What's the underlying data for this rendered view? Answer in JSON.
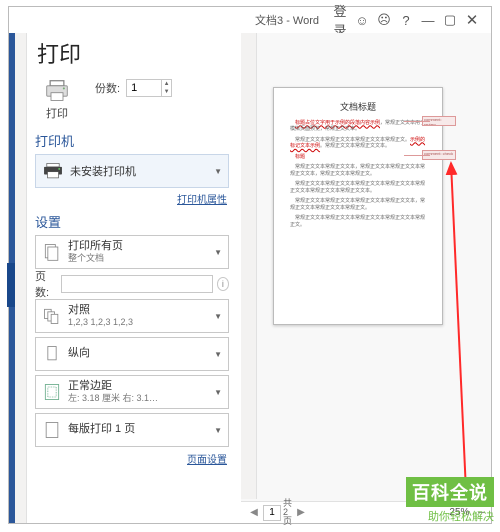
{
  "titlebar": {
    "doc": "文档3 - Word",
    "login": "登录"
  },
  "page_title": "打印",
  "print": {
    "btn": "打印",
    "copies_label": "份数:",
    "copies_value": "1"
  },
  "printer": {
    "heading": "打印机",
    "name": "未安装打印机",
    "props_link": "打印机属性"
  },
  "settings": {
    "heading": "设置",
    "scope": {
      "l1": "打印所有页",
      "l2": "整个文档"
    },
    "pages_label": "页数:",
    "collate": {
      "l1": "对照",
      "l2": "1,2,3    1,2,3    1,2,3"
    },
    "orient": {
      "l1": "纵向"
    },
    "margins": {
      "l1": "正常边距",
      "l2": "左: 3.18 厘米   右: 3.1…"
    },
    "sheets": {
      "l1": "每版打印 1 页"
    },
    "page_setup_link": "页面设置"
  },
  "preview": {
    "title": "文档标题",
    "comment1": "comment: review",
    "comment2": "comment: check"
  },
  "statusbar": {
    "page_now": "1",
    "page_total_prefix": "共",
    "page_total_n": "2",
    "page_total_suffix": "页",
    "zoom": "25%"
  },
  "watermark": {
    "big": "百科全说",
    "sub": "助你轻松解决"
  }
}
